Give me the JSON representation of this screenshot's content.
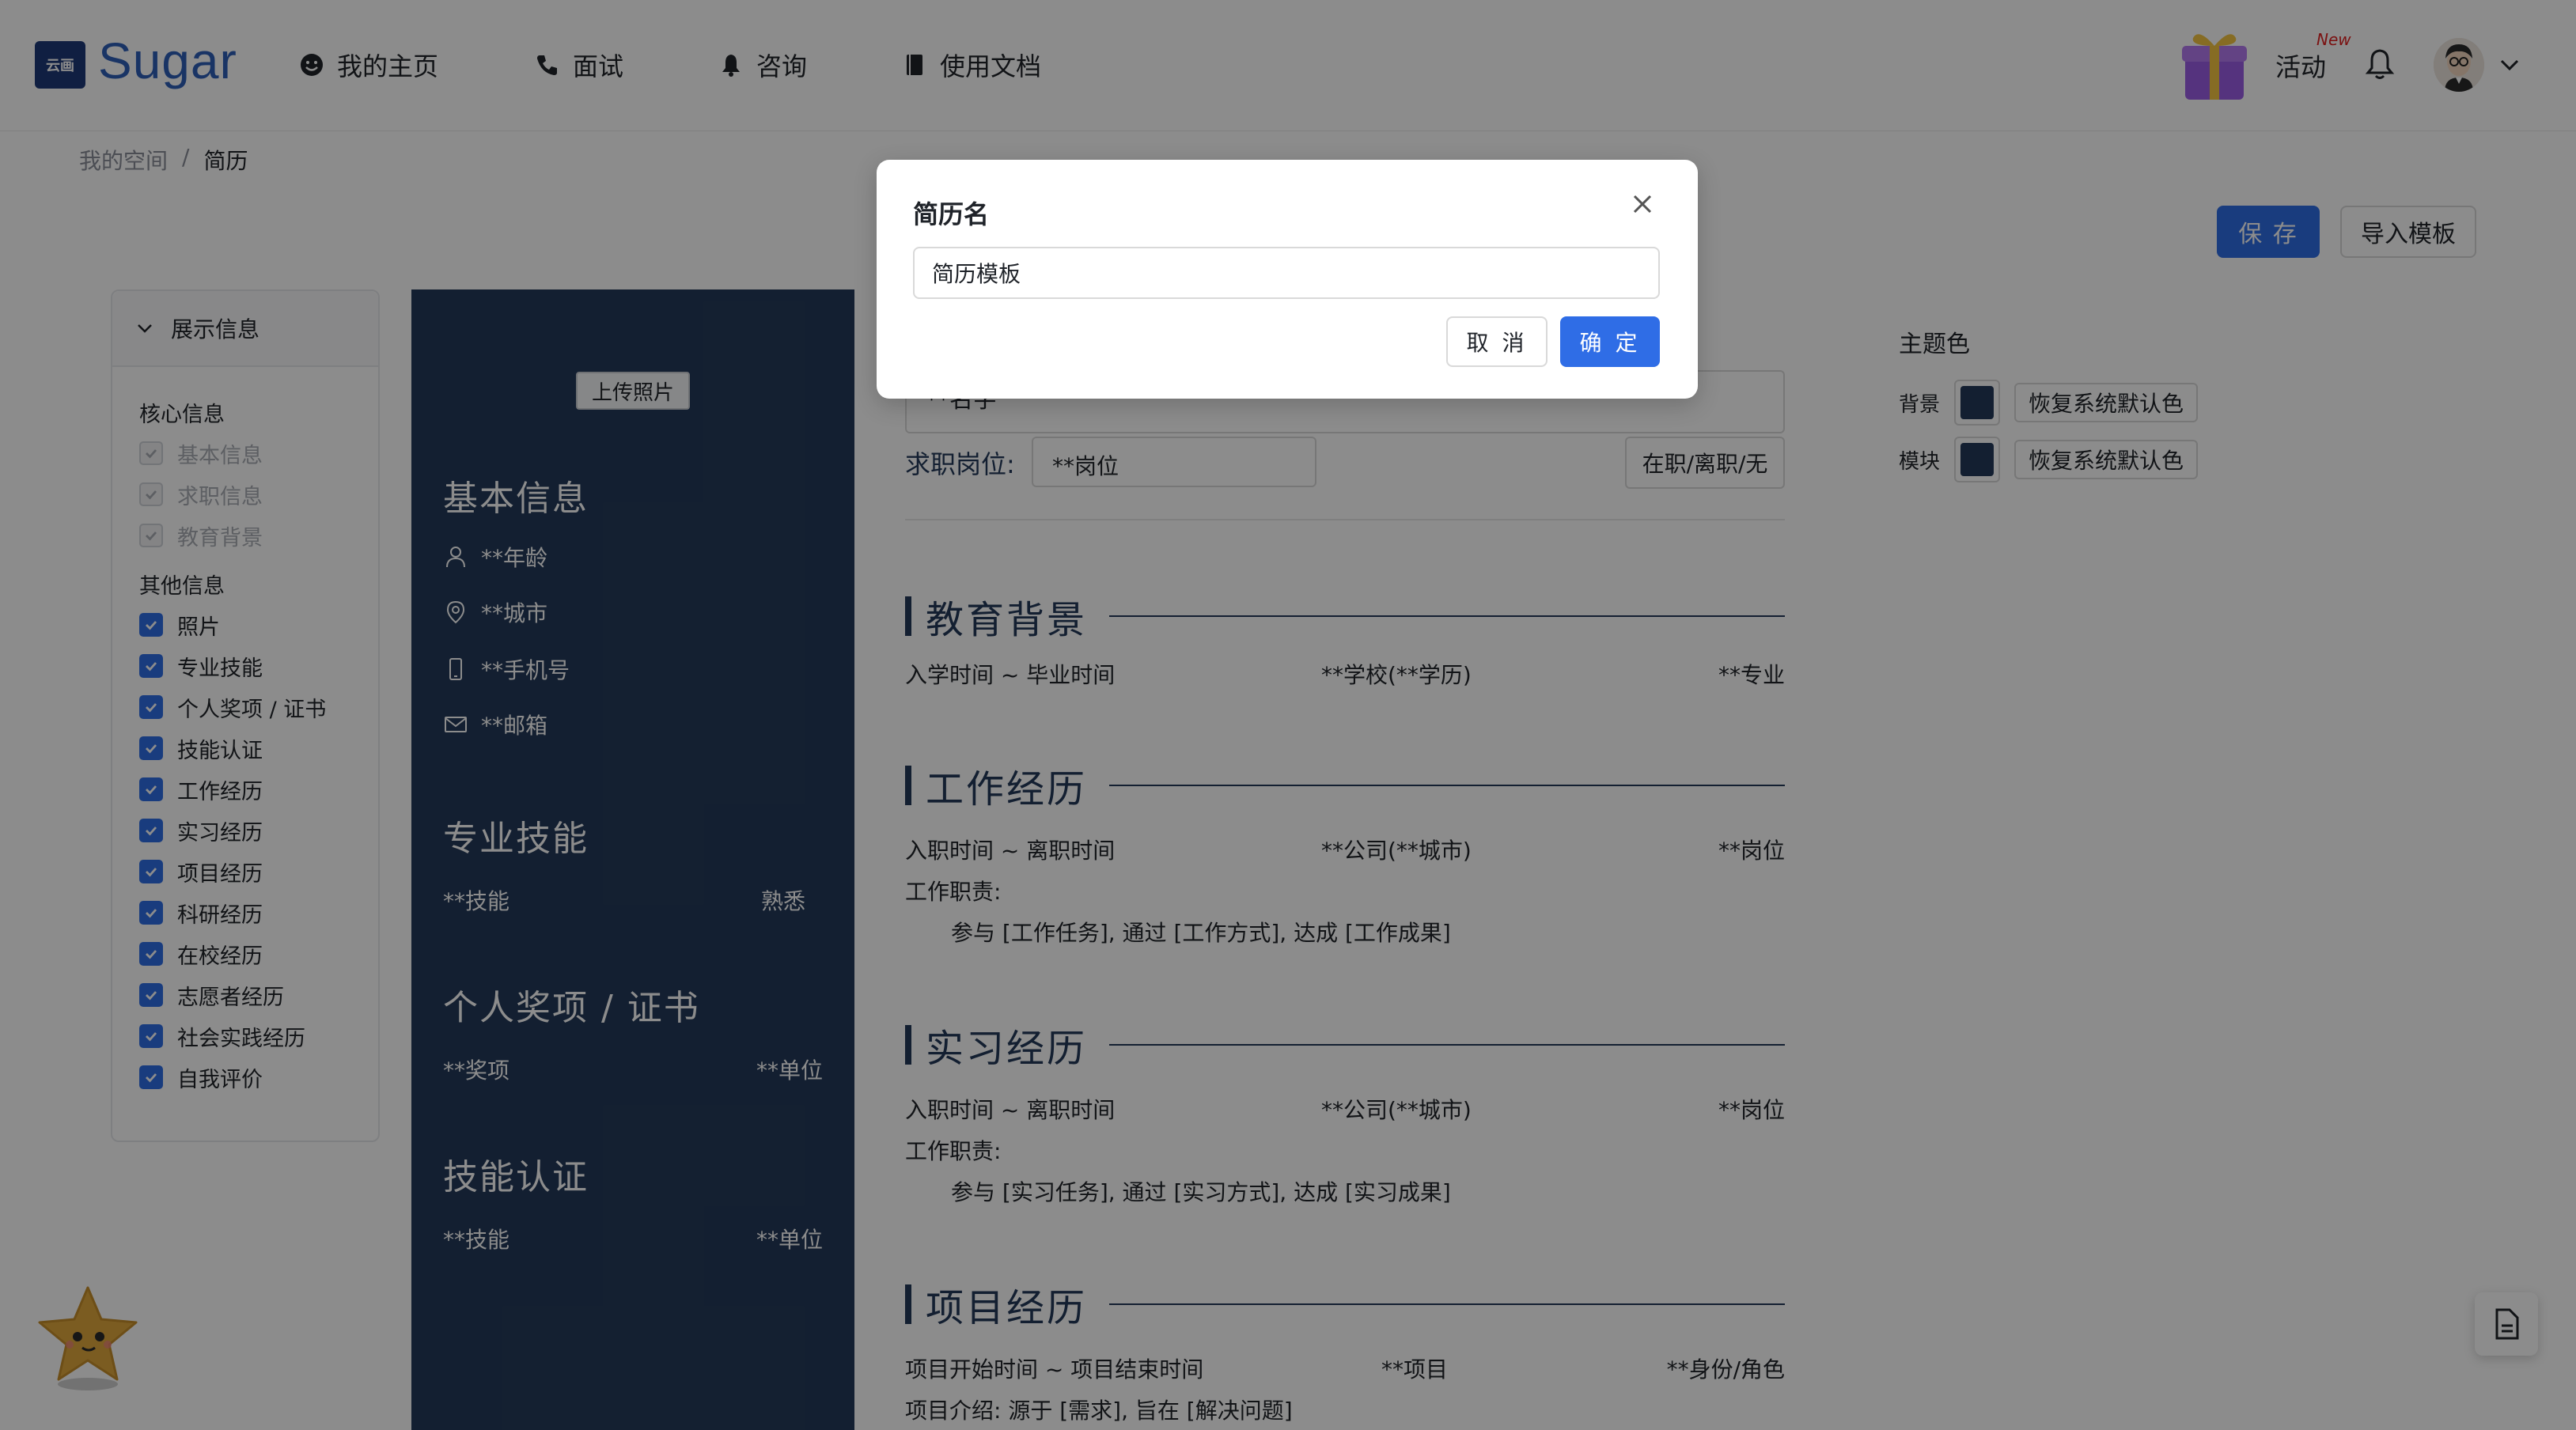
{
  "app": {
    "logo_badge": "云画",
    "logo_text": "Sugar"
  },
  "nav": {
    "home": "我的主页",
    "interview": "面试",
    "consult": "咨询",
    "docs": "使用文档",
    "activity": "活动",
    "activity_badge": "New"
  },
  "breadcrumb": {
    "root": "我的空间",
    "sep": "/",
    "current": "简历"
  },
  "actions": {
    "save": "保 存",
    "import": "导入模板"
  },
  "left_panel": {
    "header": "展示信息",
    "core_label": "核心信息",
    "core_items": [
      "基本信息",
      "求职信息",
      "教育背景"
    ],
    "other_label": "其他信息",
    "other_items": [
      "照片",
      "专业技能",
      "个人奖项 / 证书",
      "技能认证",
      "工作经历",
      "实习经历",
      "项目经历",
      "科研经历",
      "在校经历",
      "志愿者经历",
      "社会实践经历",
      "自我评价"
    ]
  },
  "resume_side": {
    "upload": "上传照片",
    "basic_title": "基本信息",
    "age": "**年龄",
    "city": "**城市",
    "phone": "**手机号",
    "email": "**邮箱",
    "skills_title": "专业技能",
    "skill": "**技能",
    "skill_level": "熟悉",
    "awards_title": "个人奖项 / 证书",
    "award": "**奖项",
    "award_unit": "**单位",
    "cert_title": "技能认证",
    "cert": "**技能",
    "cert_unit": "**单位"
  },
  "resume_main": {
    "name": "**名字",
    "job_label": "求职岗位:",
    "job_value": "**岗位",
    "job_status": "在职/离职/无",
    "edu_title": "教育背景",
    "edu_time": "入学时间 ~ 毕业时间",
    "edu_school": "**学校(**学历)",
    "edu_major": "**专业",
    "work_title": "工作经历",
    "work_time": "入职时间 ~ 离职时间",
    "work_company": "**公司(**城市)",
    "work_post": "**岗位",
    "work_duty_label": "工作职责:",
    "work_duty": "参与 [工作任务], 通过 [工作方式], 达成 [工作成果]",
    "intern_title": "实习经历",
    "intern_time": "入职时间 ~ 离职时间",
    "intern_company": "**公司(**城市)",
    "intern_post": "**岗位",
    "intern_duty_label": "工作职责:",
    "intern_duty": "参与 [实习任务], 通过 [实习方式], 达成 [实习成果]",
    "project_title": "项目经历",
    "project_time": "项目开始时间 ~ 项目结束时间",
    "project_name": "**项目",
    "project_role": "**身份/角色",
    "project_intro": "项目介绍: 源于 [需求], 旨在 [解决问题]"
  },
  "theme": {
    "title": "主题色",
    "bg_label": "背景",
    "block_label": "模块",
    "reset": "恢复系统默认色",
    "color": "#243a59"
  },
  "modal": {
    "title": "简历名",
    "input_value": "简历模板",
    "cancel": "取 消",
    "ok": "确 定"
  },
  "colors": {
    "primary": "#2f6de6",
    "resume_dark": "#243a59"
  }
}
